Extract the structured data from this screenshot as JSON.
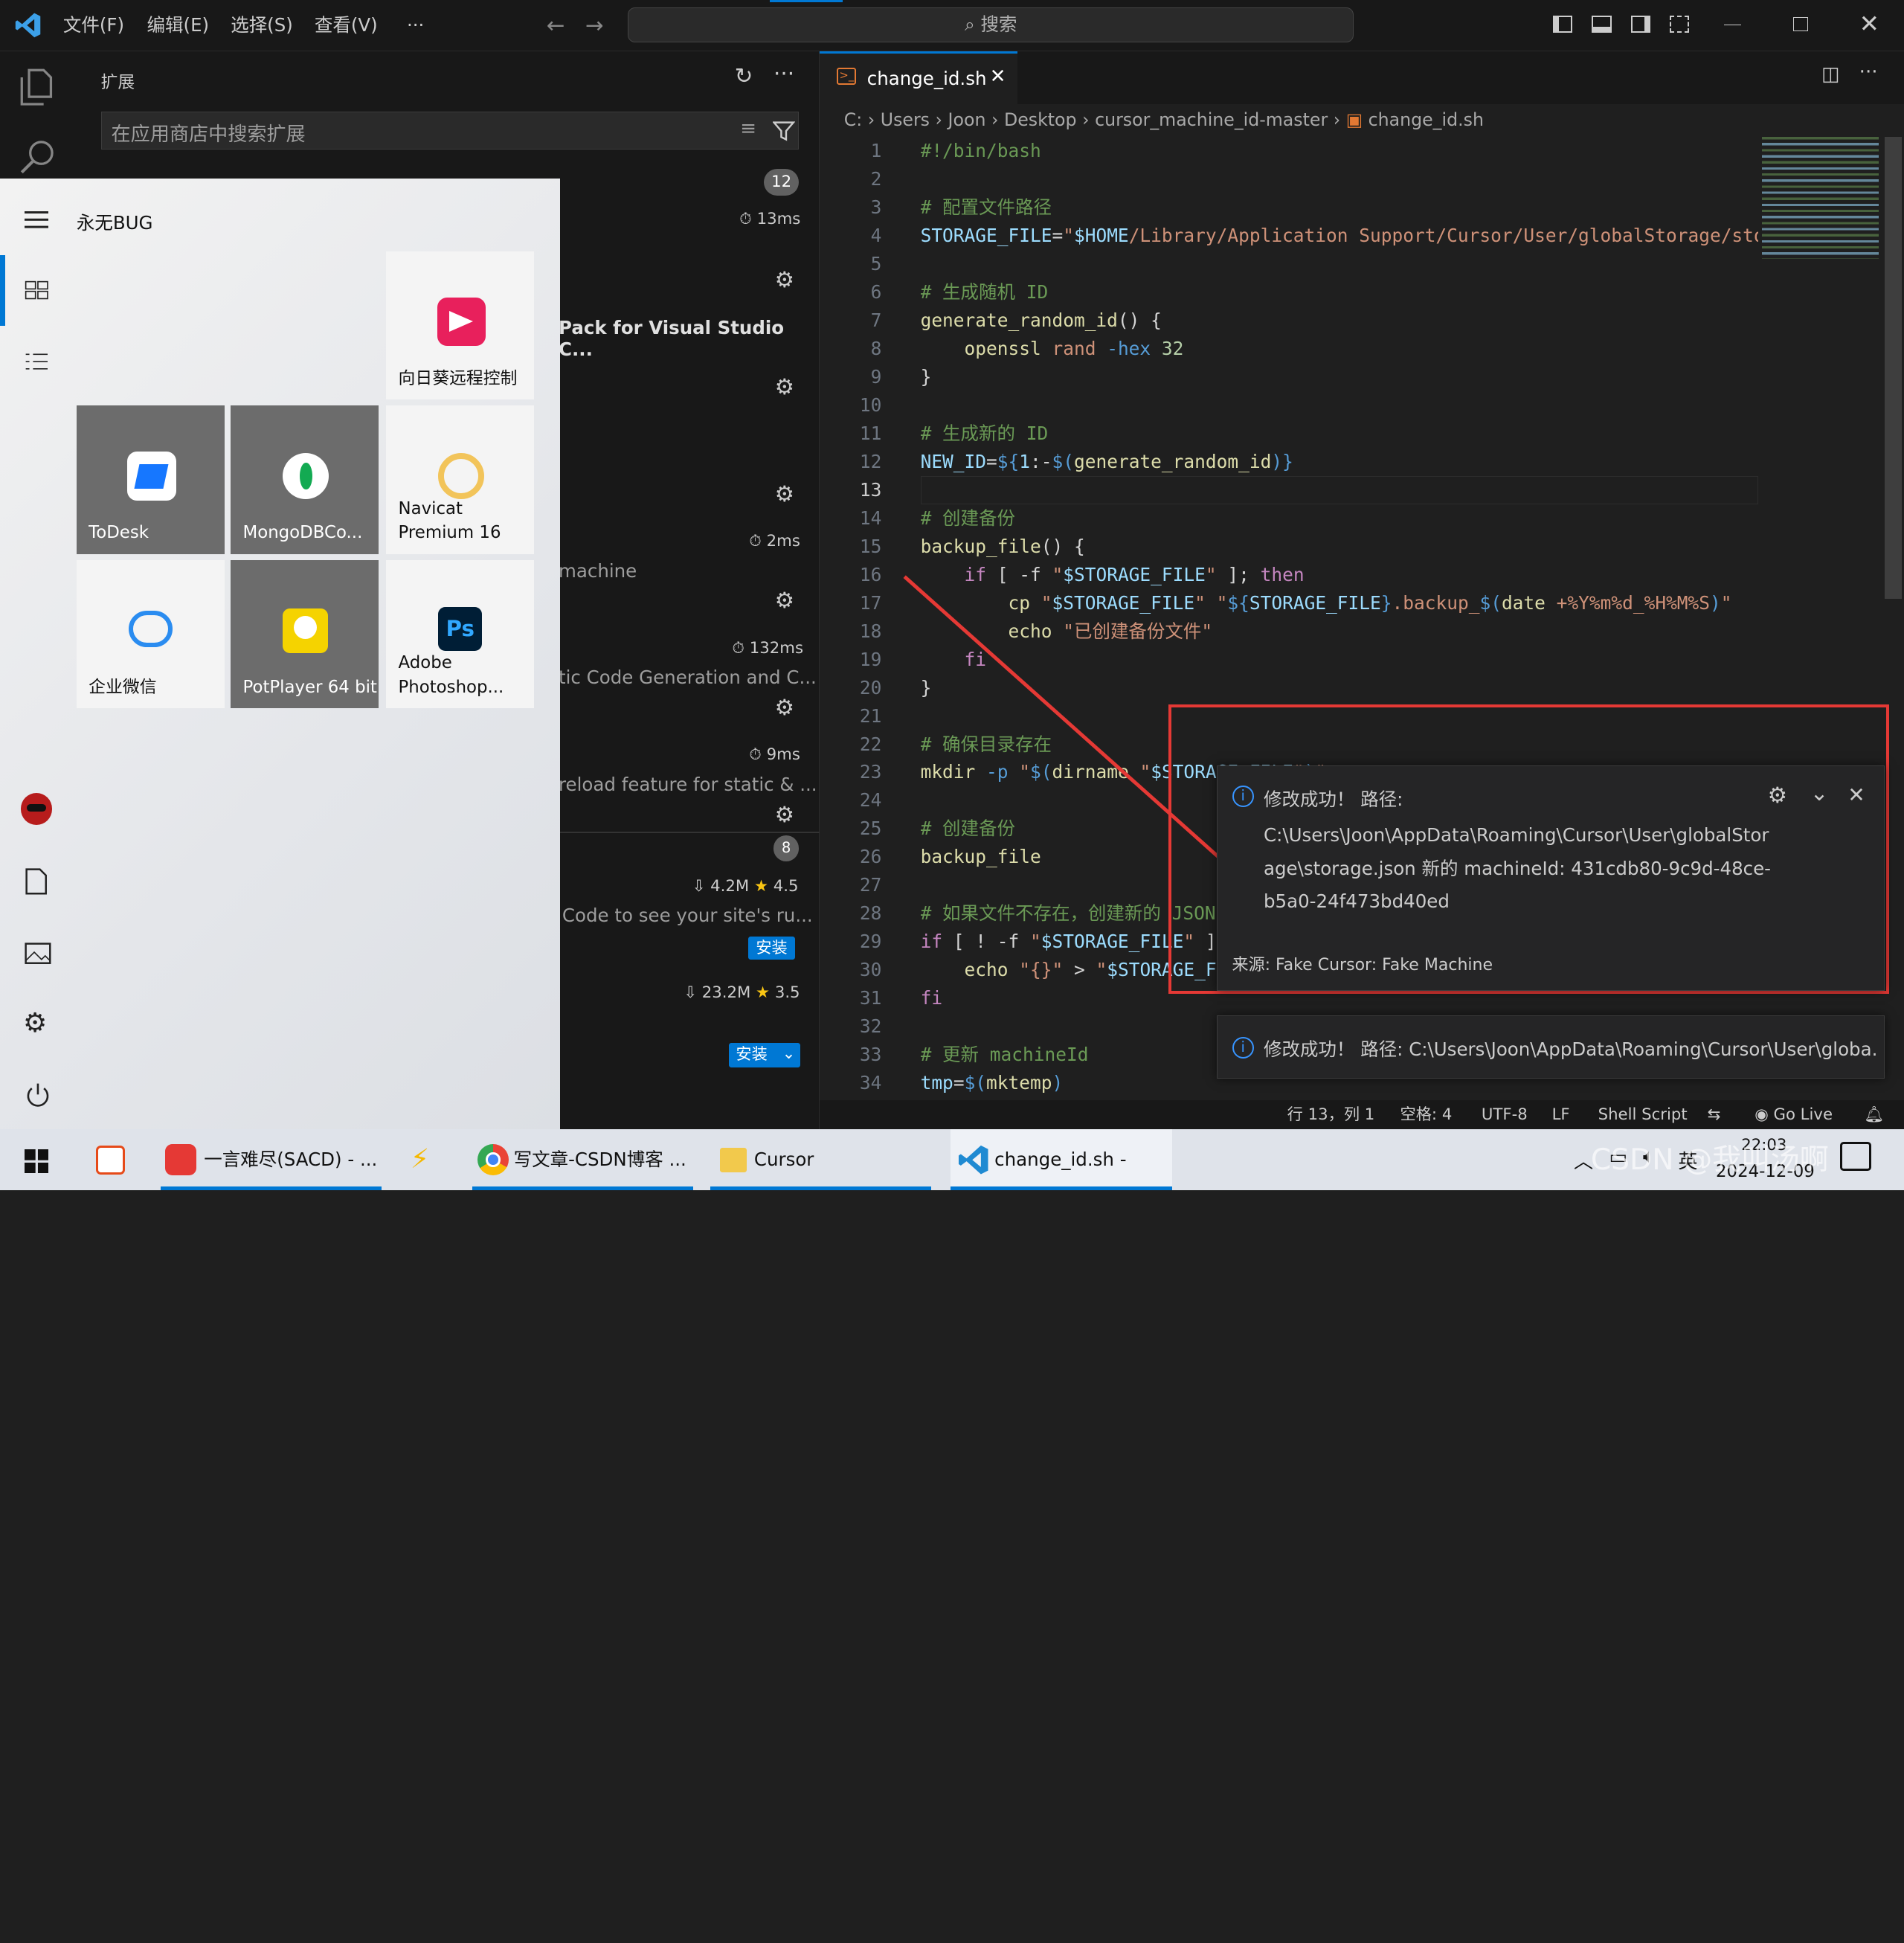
{
  "window": {
    "menus": [
      "文件(F)",
      "编辑(E)",
      "选择(S)",
      "查看(V)",
      "···"
    ],
    "search": "搜索"
  },
  "sidebar": {
    "title": "扩展",
    "search_placeholder": "在应用商店中搜索扩展",
    "installed_count": "12",
    "recommended_count": "8",
    "install_label": "安装",
    "items": [
      {
        "time": "13ms"
      },
      {
        "title": "Pack for Visual Studio C..."
      },
      {
        "time": "2ms",
        "desc": "machine"
      },
      {
        "time": "132ms",
        "desc": "tic Code Generation and C..."
      },
      {
        "time": "9ms",
        "desc": "reload feature for static & ..."
      },
      {
        "downloads": "4.2M",
        "rating": "4.5",
        "desc": "Code to see your site's ru..."
      },
      {
        "downloads": "23.2M",
        "rating": "3.5"
      }
    ]
  },
  "startmenu": {
    "user": "永无BUG",
    "tiles": [
      {
        "label": "向日葵远程控制"
      },
      {
        "label": "ToDesk"
      },
      {
        "label": "MongoDBCo..."
      },
      {
        "label": "Navicat\nPremium 16"
      },
      {
        "label": "企业微信"
      },
      {
        "label": "PotPlayer 64 bit"
      },
      {
        "label": "Adobe\nPhotoshop..."
      }
    ]
  },
  "editor": {
    "tab": "change_id.sh",
    "breadcrumb": [
      "C:",
      "Users",
      "Joon",
      "Desktop",
      "cursor_machine_id-master",
      "change_id.sh"
    ],
    "lines": [
      "1",
      "2",
      "3",
      "4",
      "5",
      "6",
      "7",
      "8",
      "9",
      "10",
      "11",
      "12",
      "13",
      "14",
      "15",
      "16",
      "17",
      "18",
      "19",
      "20",
      "21",
      "22",
      "23",
      "24",
      "25",
      "26",
      "27",
      "28",
      "29",
      "30",
      "31",
      "32",
      "33",
      "34"
    ]
  },
  "notification": {
    "title": "修改成功！ 路径:",
    "body": "C:\\Users\\Joon\\AppData\\Roaming\\Cursor\\User\\globalStorage\\storage.json 新的 machineId: 431cdb80-9c9d-48ce-b5a0-24f473bd40ed",
    "body1": "C:\\Users\\Joon\\AppData\\Roaming\\Cursor\\User\\globalStor",
    "body2": "age\\storage.json 新的 machineId: 431cdb80-9c9d-48ce-",
    "body3": "b5a0-24f473bd40ed",
    "source": "来源: Fake Cursor: Fake Machine",
    "collapsed": "修改成功！ 路径: C:\\Users\\Joon\\AppData\\Roaming\\Cursor\\User\\globa..."
  },
  "status": {
    "pos": "行 13，列 1",
    "spaces": "空格: 4",
    "enc": "UTF-8",
    "eol": "LF",
    "lang": "Shell Script",
    "live": "Go Live"
  },
  "taskbar": {
    "items": [
      "一言难尽(SACD) - ...",
      "写文章-CSDN博客 ...",
      "Cursor",
      "change_id.sh - Vis..."
    ],
    "lang": "英",
    "time": "22:03",
    "date": "2024-12-09",
    "watermark": "CSDN @我叫汤啊"
  },
  "colors": {
    "accent": "#0078d4",
    "annotation": "#e53935"
  }
}
